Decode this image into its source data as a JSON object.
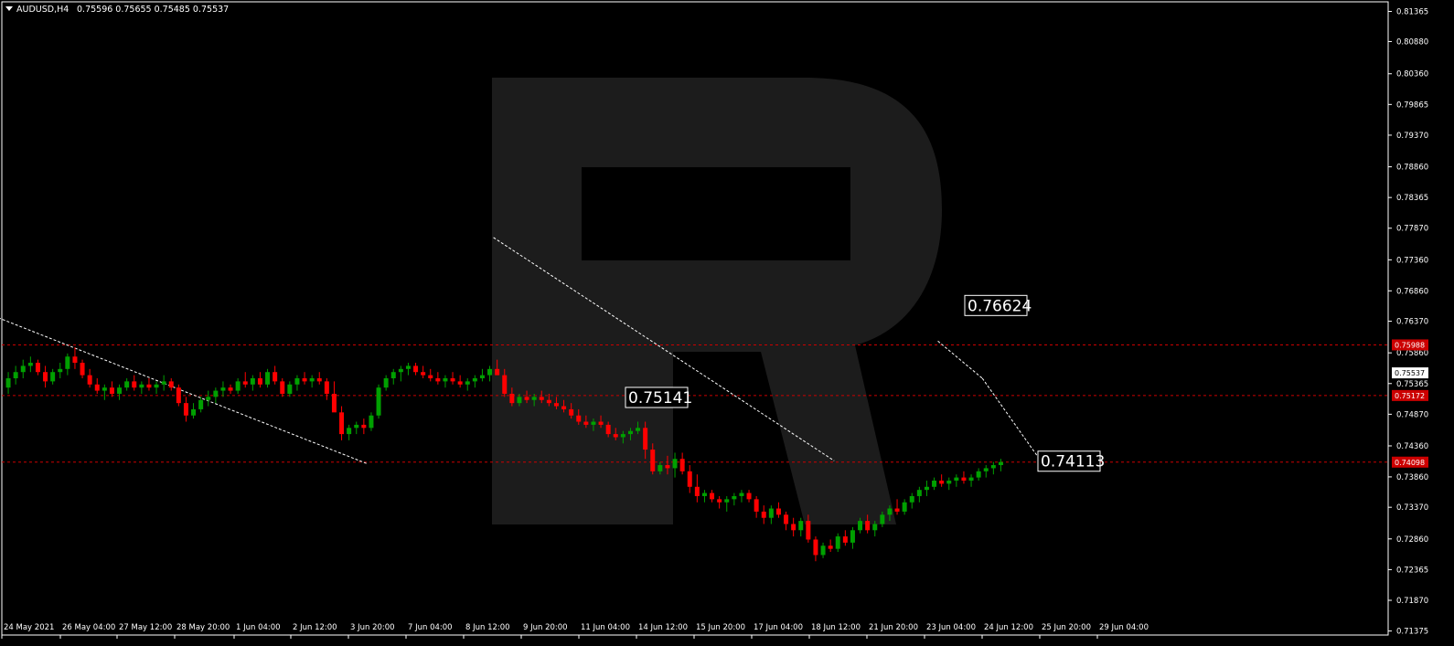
{
  "header": {
    "symbol": "AUDUSD,H4",
    "ohlc": "0.75596 0.75655 0.75485 0.75537"
  },
  "colors": {
    "background": "#000000",
    "bull": "#00a000",
    "bear": "#ff0000",
    "grid_line": "#ffffff",
    "level_line": "#cc0000",
    "watermark": "#1c1c1c",
    "forecast_line": "#ffffff"
  },
  "chart_data": {
    "type": "candlestick",
    "title": "AUDUSD,H4",
    "x_ticks": [
      "24 May 2021",
      "26 May 04:00",
      "27 May 12:00",
      "28 May 20:00",
      "1 Jun 04:00",
      "2 Jun 12:00",
      "3 Jun 20:00",
      "7 Jun 04:00",
      "8 Jun 12:00",
      "9 Jun 20:00",
      "11 Jun 04:00",
      "14 Jun 12:00",
      "15 Jun 20:00",
      "17 Jun 04:00",
      "18 Jun 12:00",
      "21 Jun 20:00",
      "23 Jun 04:00",
      "24 Jun 12:00",
      "25 Jun 20:00",
      "29 Jun 04:00"
    ],
    "y_ticks": [
      "0.81365",
      "0.80880",
      "0.80360",
      "0.79865",
      "0.79370",
      "0.78860",
      "0.78365",
      "0.77870",
      "0.77360",
      "0.76860",
      "0.76370",
      "0.75860",
      "0.75365",
      "0.74870",
      "0.74360",
      "0.73860",
      "0.73370",
      "0.72860",
      "0.72365",
      "0.71870",
      "0.71375"
    ],
    "ylim": [
      0.7131,
      0.8152
    ],
    "current_price": "0.75537",
    "levels": [
      {
        "label": "0.75988",
        "value": 0.75988
      },
      {
        "label": "0.75172",
        "value": 0.75172
      },
      {
        "label": "0.74098",
        "value": 0.74098
      }
    ],
    "annotations": [
      {
        "label": "0.76624",
        "value": 0.76624
      },
      {
        "label": "0.75141",
        "value": 0.75141
      },
      {
        "label": "0.74113",
        "value": 0.74113
      }
    ],
    "forecast_path": [
      {
        "bar": 126,
        "price": 0.7605
      },
      {
        "bar": 132,
        "price": 0.7545
      },
      {
        "bar": 140,
        "price": 0.741
      }
    ],
    "trend_lines": [
      {
        "from": {
          "bar": -2,
          "price": 0.7648
        },
        "to": {
          "bar": 49,
          "price": 0.7407
        }
      },
      {
        "from": {
          "bar": 66,
          "price": 0.7772
        },
        "to": {
          "bar": 112,
          "price": 0.7412
        }
      }
    ],
    "candles": [
      [
        0.753,
        0.7555,
        0.752,
        0.7545
      ],
      [
        0.7545,
        0.7565,
        0.7535,
        0.7555
      ],
      [
        0.7555,
        0.7575,
        0.7545,
        0.7565
      ],
      [
        0.7565,
        0.758,
        0.7555,
        0.757
      ],
      [
        0.757,
        0.7575,
        0.755,
        0.7555
      ],
      [
        0.7555,
        0.7565,
        0.753,
        0.754
      ],
      [
        0.754,
        0.756,
        0.7535,
        0.7555
      ],
      [
        0.7555,
        0.757,
        0.7545,
        0.756
      ],
      [
        0.756,
        0.7585,
        0.755,
        0.758
      ],
      [
        0.758,
        0.7595,
        0.756,
        0.757
      ],
      [
        0.757,
        0.7575,
        0.7545,
        0.755
      ],
      [
        0.755,
        0.756,
        0.753,
        0.7535
      ],
      [
        0.7535,
        0.7545,
        0.752,
        0.7525
      ],
      [
        0.7525,
        0.7535,
        0.751,
        0.753
      ],
      [
        0.753,
        0.754,
        0.7515,
        0.752
      ],
      [
        0.752,
        0.7535,
        0.751,
        0.753
      ],
      [
        0.753,
        0.7545,
        0.7525,
        0.754
      ],
      [
        0.754,
        0.755,
        0.7525,
        0.753
      ],
      [
        0.753,
        0.754,
        0.752,
        0.7535
      ],
      [
        0.7535,
        0.7545,
        0.7525,
        0.753
      ],
      [
        0.753,
        0.754,
        0.752,
        0.7535
      ],
      [
        0.7535,
        0.755,
        0.7525,
        0.754
      ],
      [
        0.754,
        0.7545,
        0.7525,
        0.753
      ],
      [
        0.753,
        0.7535,
        0.75,
        0.7505
      ],
      [
        0.7505,
        0.7515,
        0.7475,
        0.7485
      ],
      [
        0.7485,
        0.7505,
        0.748,
        0.7495
      ],
      [
        0.7495,
        0.7515,
        0.749,
        0.751
      ],
      [
        0.751,
        0.7525,
        0.75,
        0.7515
      ],
      [
        0.7515,
        0.753,
        0.7505,
        0.7525
      ],
      [
        0.7525,
        0.754,
        0.7515,
        0.753
      ],
      [
        0.753,
        0.7535,
        0.752,
        0.7525
      ],
      [
        0.7525,
        0.7545,
        0.752,
        0.754
      ],
      [
        0.754,
        0.7555,
        0.753,
        0.7535
      ],
      [
        0.7535,
        0.755,
        0.7525,
        0.7545
      ],
      [
        0.7545,
        0.7555,
        0.753,
        0.7535
      ],
      [
        0.7535,
        0.756,
        0.753,
        0.7555
      ],
      [
        0.7555,
        0.7565,
        0.7535,
        0.754
      ],
      [
        0.754,
        0.7545,
        0.7515,
        0.752
      ],
      [
        0.752,
        0.754,
        0.7515,
        0.7535
      ],
      [
        0.7535,
        0.755,
        0.7525,
        0.7545
      ],
      [
        0.7545,
        0.7555,
        0.7535,
        0.754
      ],
      [
        0.754,
        0.755,
        0.753,
        0.7545
      ],
      [
        0.7545,
        0.7555,
        0.7535,
        0.754
      ],
      [
        0.754,
        0.7545,
        0.751,
        0.752
      ],
      [
        0.752,
        0.754,
        0.7505,
        0.749
      ],
      [
        0.749,
        0.75,
        0.7445,
        0.7455
      ],
      [
        0.7455,
        0.747,
        0.7445,
        0.7465
      ],
      [
        0.7465,
        0.7475,
        0.7455,
        0.747
      ],
      [
        0.747,
        0.748,
        0.7455,
        0.7465
      ],
      [
        0.7465,
        0.749,
        0.746,
        0.7485
      ],
      [
        0.7485,
        0.7535,
        0.748,
        0.753
      ],
      [
        0.753,
        0.755,
        0.7525,
        0.7545
      ],
      [
        0.7545,
        0.756,
        0.7535,
        0.7555
      ],
      [
        0.7555,
        0.7565,
        0.754,
        0.756
      ],
      [
        0.756,
        0.757,
        0.755,
        0.7565
      ],
      [
        0.7565,
        0.757,
        0.755,
        0.7555
      ],
      [
        0.7555,
        0.7565,
        0.7545,
        0.755
      ],
      [
        0.755,
        0.756,
        0.754,
        0.7545
      ],
      [
        0.7545,
        0.7555,
        0.7535,
        0.754
      ],
      [
        0.754,
        0.755,
        0.753,
        0.7545
      ],
      [
        0.7545,
        0.7555,
        0.7535,
        0.754
      ],
      [
        0.754,
        0.755,
        0.753,
        0.7535
      ],
      [
        0.7535,
        0.7545,
        0.7525,
        0.754
      ],
      [
        0.754,
        0.755,
        0.753,
        0.7545
      ],
      [
        0.7545,
        0.756,
        0.754,
        0.755
      ],
      [
        0.755,
        0.7565,
        0.754,
        0.756
      ],
      [
        0.756,
        0.7575,
        0.755,
        0.755
      ],
      [
        0.755,
        0.756,
        0.7515,
        0.752
      ],
      [
        0.752,
        0.753,
        0.75,
        0.7505
      ],
      [
        0.7505,
        0.752,
        0.75,
        0.7515
      ],
      [
        0.7515,
        0.7525,
        0.7505,
        0.751
      ],
      [
        0.751,
        0.752,
        0.75,
        0.7515
      ],
      [
        0.7515,
        0.7525,
        0.7505,
        0.751
      ],
      [
        0.751,
        0.752,
        0.75,
        0.7505
      ],
      [
        0.7505,
        0.7515,
        0.7495,
        0.75
      ],
      [
        0.75,
        0.751,
        0.749,
        0.7495
      ],
      [
        0.7495,
        0.7505,
        0.748,
        0.7485
      ],
      [
        0.7485,
        0.7495,
        0.747,
        0.7475
      ],
      [
        0.7475,
        0.7485,
        0.7465,
        0.747
      ],
      [
        0.747,
        0.748,
        0.746,
        0.7475
      ],
      [
        0.7475,
        0.7485,
        0.7465,
        0.747
      ],
      [
        0.747,
        0.7475,
        0.745,
        0.7455
      ],
      [
        0.7455,
        0.7465,
        0.7445,
        0.745
      ],
      [
        0.745,
        0.746,
        0.744,
        0.7455
      ],
      [
        0.7455,
        0.7465,
        0.7445,
        0.746
      ],
      [
        0.746,
        0.7475,
        0.7455,
        0.7465
      ],
      [
        0.7465,
        0.7475,
        0.7415,
        0.743
      ],
      [
        0.743,
        0.744,
        0.739,
        0.7395
      ],
      [
        0.7395,
        0.741,
        0.739,
        0.7405
      ],
      [
        0.7405,
        0.742,
        0.739,
        0.74
      ],
      [
        0.74,
        0.7425,
        0.7385,
        0.7415
      ],
      [
        0.7415,
        0.7425,
        0.739,
        0.7395
      ],
      [
        0.7395,
        0.7405,
        0.736,
        0.737
      ],
      [
        0.737,
        0.739,
        0.7345,
        0.7355
      ],
      [
        0.7355,
        0.7365,
        0.7345,
        0.736
      ],
      [
        0.736,
        0.7365,
        0.7345,
        0.735
      ],
      [
        0.735,
        0.7355,
        0.7335,
        0.7345
      ],
      [
        0.7345,
        0.7355,
        0.733,
        0.735
      ],
      [
        0.735,
        0.736,
        0.734,
        0.7355
      ],
      [
        0.7355,
        0.7365,
        0.7345,
        0.736
      ],
      [
        0.736,
        0.7365,
        0.7345,
        0.735
      ],
      [
        0.735,
        0.7355,
        0.732,
        0.733
      ],
      [
        0.733,
        0.734,
        0.731,
        0.732
      ],
      [
        0.732,
        0.734,
        0.731,
        0.7335
      ],
      [
        0.7335,
        0.7345,
        0.732,
        0.7325
      ],
      [
        0.7325,
        0.733,
        0.73,
        0.731
      ],
      [
        0.731,
        0.732,
        0.729,
        0.73
      ],
      [
        0.73,
        0.732,
        0.729,
        0.7315
      ],
      [
        0.7315,
        0.7325,
        0.728,
        0.7285
      ],
      [
        0.7285,
        0.729,
        0.725,
        0.726
      ],
      [
        0.726,
        0.728,
        0.7255,
        0.7275
      ],
      [
        0.7275,
        0.7285,
        0.7265,
        0.727
      ],
      [
        0.727,
        0.7295,
        0.7265,
        0.729
      ],
      [
        0.729,
        0.73,
        0.7275,
        0.728
      ],
      [
        0.728,
        0.7305,
        0.727,
        0.73
      ],
      [
        0.73,
        0.732,
        0.7295,
        0.7315
      ],
      [
        0.7315,
        0.7325,
        0.7295,
        0.73
      ],
      [
        0.73,
        0.7315,
        0.729,
        0.731
      ],
      [
        0.731,
        0.733,
        0.7305,
        0.7325
      ],
      [
        0.7325,
        0.734,
        0.7315,
        0.7335
      ],
      [
        0.7335,
        0.735,
        0.7325,
        0.733
      ],
      [
        0.733,
        0.735,
        0.7325,
        0.7345
      ],
      [
        0.7345,
        0.736,
        0.7335,
        0.7355
      ],
      [
        0.7355,
        0.737,
        0.7345,
        0.7365
      ],
      [
        0.7365,
        0.738,
        0.7355,
        0.737
      ],
      [
        0.737,
        0.7385,
        0.7365,
        0.738
      ],
      [
        0.738,
        0.739,
        0.737,
        0.7375
      ],
      [
        0.7375,
        0.7385,
        0.7365,
        0.738
      ],
      [
        0.738,
        0.739,
        0.737,
        0.7385
      ],
      [
        0.7385,
        0.7395,
        0.7375,
        0.738
      ],
      [
        0.738,
        0.739,
        0.737,
        0.7385
      ],
      [
        0.7385,
        0.74,
        0.738,
        0.7395
      ],
      [
        0.7395,
        0.7405,
        0.7385,
        0.74
      ],
      [
        0.74,
        0.741,
        0.739,
        0.7405
      ],
      [
        0.7405,
        0.7415,
        0.7395,
        0.741
      ]
    ]
  }
}
